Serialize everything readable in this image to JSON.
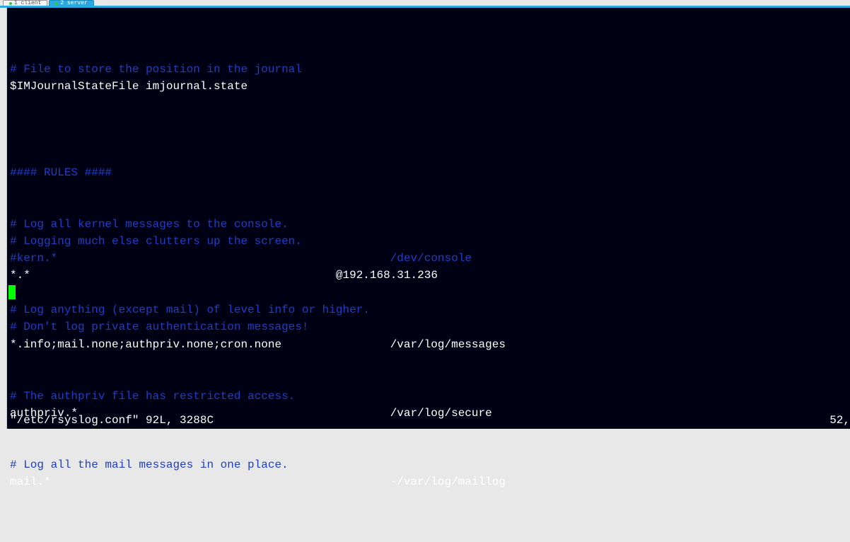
{
  "tabs": [
    {
      "label": "1 client",
      "active": false
    },
    {
      "label": "2 server",
      "active": true
    }
  ],
  "lines": {
    "l1": "# File to store the position in the journal",
    "l2": "$IMJournalStateFile imjournal.state",
    "l3": "#### RULES ####",
    "l4": "# Log all kernel messages to the console.",
    "l5": "# Logging much else clutters up the screen.",
    "l6a": "#kern.*",
    "l6b": "/dev/console",
    "l7a": "*.*",
    "l7b": "@192.168.31.236",
    "l8": "# Log anything (except mail) of level info or higher.",
    "l9": "# Don't log private authentication messages!",
    "l10a": "*.info;mail.none;authpriv.none;cron.none",
    "l10b": "/var/log/messages",
    "l11": "# The authpriv file has restricted access.",
    "l12a": "authpriv.*",
    "l12b": "/var/log/secure",
    "l13": "# Log all the mail messages in one place.",
    "l14a": "mail.*",
    "l14b": "-/var/log/maillog"
  },
  "status": {
    "file": "\"/etc/rsyslog.conf\" 92L, 3288C",
    "pos": "52,"
  }
}
